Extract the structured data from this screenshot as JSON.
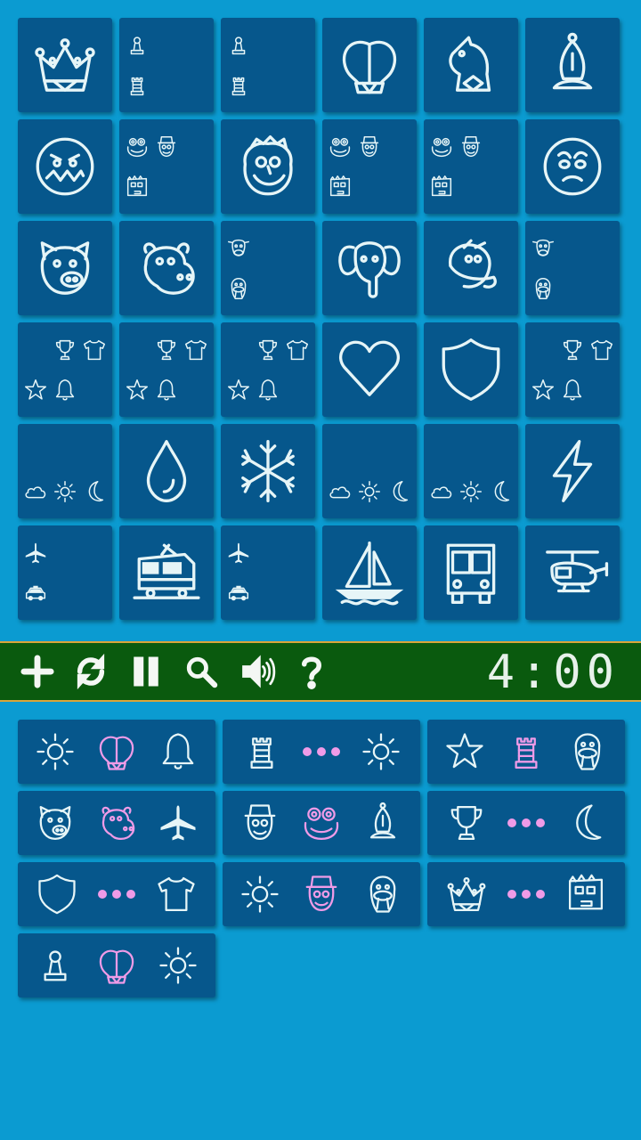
{
  "colors": {
    "background": "#0b9bd1",
    "tile": "#06578c",
    "toolbar": "#0a5a0e",
    "toolbar_border": "#d9a53a",
    "icon": "#e6f5f7",
    "highlight": "#ef9be7"
  },
  "board": {
    "tiles": [
      {
        "icons": [
          "queen-icon"
        ]
      },
      {
        "icons": [
          "pawn-icon",
          "rook-icon"
        ]
      },
      {
        "icons": [
          "pawn-icon",
          "rook-icon"
        ]
      },
      {
        "icons": [
          "king-icon"
        ]
      },
      {
        "icons": [
          "knight-icon"
        ]
      },
      {
        "icons": [
          "bishop-icon"
        ]
      },
      {
        "icons": [
          "zigzag-face-icon"
        ]
      },
      {
        "icons": [
          "frog-face-icon",
          "top-hat-face-icon",
          "box-face-icon"
        ]
      },
      {
        "icons": [
          "silly-face-icon"
        ]
      },
      {
        "icons": [
          "frog-face-icon",
          "top-hat-face-icon",
          "box-face-icon"
        ]
      },
      {
        "icons": [
          "frog-face-icon",
          "top-hat-face-icon",
          "box-face-icon"
        ]
      },
      {
        "icons": [
          "worried-face-icon"
        ]
      },
      {
        "icons": [
          "pig-icon"
        ]
      },
      {
        "icons": [
          "hippo-icon"
        ]
      },
      {
        "icons": [
          "cow-icon",
          "walrus-icon"
        ]
      },
      {
        "icons": [
          "elephant-icon"
        ]
      },
      {
        "icons": [
          "camel-icon"
        ]
      },
      {
        "icons": [
          "cow-icon",
          "walrus-icon"
        ]
      },
      {
        "icons": [
          "trophy-icon",
          "tshirt-icon",
          "star-icon",
          "bell-icon"
        ]
      },
      {
        "icons": [
          "trophy-icon",
          "tshirt-icon",
          "star-icon",
          "bell-icon"
        ]
      },
      {
        "icons": [
          "trophy-icon",
          "tshirt-icon",
          "star-icon",
          "bell-icon"
        ]
      },
      {
        "icons": [
          "heart-icon"
        ]
      },
      {
        "icons": [
          "shield-icon"
        ]
      },
      {
        "icons": [
          "trophy-icon",
          "tshirt-icon",
          "star-icon",
          "bell-icon"
        ]
      },
      {
        "icons": [
          "cloud-icon",
          "sun-icon",
          "moon-icon"
        ]
      },
      {
        "icons": [
          "raindrop-icon"
        ]
      },
      {
        "icons": [
          "snowflake-icon"
        ]
      },
      {
        "icons": [
          "cloud-icon",
          "sun-icon",
          "moon-icon"
        ]
      },
      {
        "icons": [
          "cloud-icon",
          "sun-icon",
          "moon-icon"
        ]
      },
      {
        "icons": [
          "lightning-icon"
        ]
      },
      {
        "icons": [
          "airplane-icon",
          "taxi-icon"
        ]
      },
      {
        "icons": [
          "train-icon"
        ]
      },
      {
        "icons": [
          "airplane-icon",
          "taxi-icon"
        ]
      },
      {
        "icons": [
          "sailboat-icon"
        ]
      },
      {
        "icons": [
          "bus-icon"
        ]
      },
      {
        "icons": [
          "helicopter-icon"
        ]
      }
    ]
  },
  "toolbar": {
    "buttons": [
      "plus-icon",
      "refresh-icon",
      "pause-icon",
      "search-icon",
      "speaker-icon",
      "help-icon"
    ],
    "timer": "4:00"
  },
  "tasks": [
    {
      "items": [
        {
          "icon": "sun-icon",
          "highlight": false
        },
        {
          "icon": "king-icon",
          "highlight": true
        },
        {
          "icon": "bell-icon",
          "highlight": false
        }
      ]
    },
    {
      "items": [
        {
          "icon": "rook-icon",
          "highlight": false
        },
        {
          "icon": "dots",
          "highlight": true
        },
        {
          "icon": "sun-icon",
          "highlight": false
        }
      ]
    },
    {
      "items": [
        {
          "icon": "star-icon",
          "highlight": false
        },
        {
          "icon": "rook-icon",
          "highlight": true
        },
        {
          "icon": "walrus-icon",
          "highlight": false
        }
      ]
    },
    {
      "items": [
        {
          "icon": "pig-icon",
          "highlight": false
        },
        {
          "icon": "hippo-icon",
          "highlight": true
        },
        {
          "icon": "airplane-icon",
          "highlight": false
        }
      ]
    },
    {
      "items": [
        {
          "icon": "top-hat-face-icon",
          "highlight": false
        },
        {
          "icon": "frog-face-icon",
          "highlight": true
        },
        {
          "icon": "bishop-icon",
          "highlight": false
        }
      ]
    },
    {
      "items": [
        {
          "icon": "trophy-icon",
          "highlight": false
        },
        {
          "icon": "dots",
          "highlight": true
        },
        {
          "icon": "moon-icon",
          "highlight": false
        }
      ]
    },
    {
      "items": [
        {
          "icon": "shield-icon",
          "highlight": false
        },
        {
          "icon": "dots",
          "highlight": true
        },
        {
          "icon": "tshirt-icon",
          "highlight": false
        }
      ]
    },
    {
      "items": [
        {
          "icon": "sun-icon",
          "highlight": false
        },
        {
          "icon": "top-hat-face-icon",
          "highlight": true
        },
        {
          "icon": "walrus-icon",
          "highlight": false
        }
      ]
    },
    {
      "items": [
        {
          "icon": "queen-icon",
          "highlight": false
        },
        {
          "icon": "dots",
          "highlight": true
        },
        {
          "icon": "box-face-icon",
          "highlight": false
        }
      ]
    },
    {
      "items": [
        {
          "icon": "pawn-icon",
          "highlight": false
        },
        {
          "icon": "king-icon",
          "highlight": true
        },
        {
          "icon": "sun-icon",
          "highlight": false
        }
      ]
    }
  ]
}
